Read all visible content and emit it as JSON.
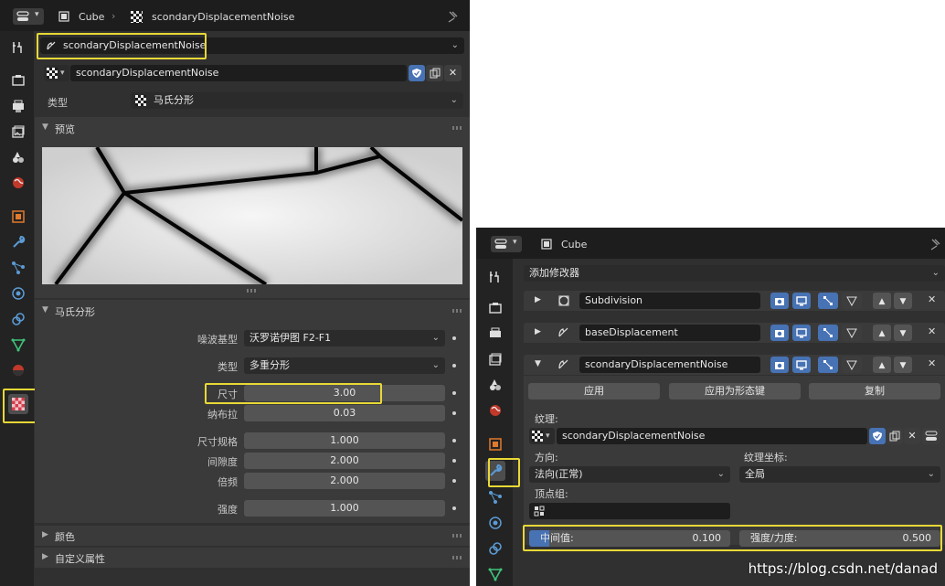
{
  "left_panel": {
    "header": {
      "object_name": "Cube",
      "texture_name": "scondaryDisplacementNoise"
    },
    "texture_selector": "scondaryDisplacementNoise",
    "datablock": {
      "name": "scondaryDisplacementNoise"
    },
    "type_row": {
      "label": "类型",
      "value": "马氏分形"
    },
    "preview_section": {
      "title": "预览"
    },
    "fractal_section": {
      "title": "马氏分形",
      "noise_basis": {
        "label": "噪波基型",
        "value": "沃罗诺伊图 F2-F1"
      },
      "type": {
        "label": "类型",
        "value": "多重分形"
      },
      "size": {
        "label": "尺寸",
        "value": "3.00"
      },
      "nabla": {
        "label": "纳布拉",
        "value": "0.03"
      },
      "dimension": {
        "label": "尺寸规格",
        "value": "1.000"
      },
      "lacunarity": {
        "label": "间隙度",
        "value": "2.000"
      },
      "octaves": {
        "label": "倍频",
        "value": "2.000"
      },
      "intensity": {
        "label": "强度",
        "value": "1.000"
      }
    },
    "color_section": {
      "title": "颜色"
    },
    "custom_props_section": {
      "title": "自定义属性"
    }
  },
  "right_panel": {
    "header": {
      "object_name": "Cube"
    },
    "add_modifier": "添加修改器",
    "modifiers": [
      {
        "name": "Subdivision",
        "icon": "subdivision-icon"
      },
      {
        "name": "baseDisplacement",
        "icon": "displace-icon"
      },
      {
        "name": "scondaryDisplacementNoise",
        "icon": "displace-icon"
      }
    ],
    "actions": {
      "apply": "应用",
      "apply_as_shapekey": "应用为形态键",
      "copy": "复制"
    },
    "texture_label": "纹理:",
    "texture_name": "scondaryDisplacementNoise",
    "direction_label": "方向:",
    "direction_value": "法向(正常)",
    "texcoord_label": "纹理坐标:",
    "texcoord_value": "全局",
    "vertex_group_label": "顶点组:",
    "midlevel": {
      "label": "中间值:",
      "value": "0.100"
    },
    "strength": {
      "label": "强度/力度:",
      "value": "0.500"
    }
  },
  "watermark": "https://blog.csdn.net/danad",
  "colors": {
    "highlight": "#e8d836",
    "active_blue": "#4772b3",
    "panel_bg": "#303030",
    "field": "#545454"
  }
}
